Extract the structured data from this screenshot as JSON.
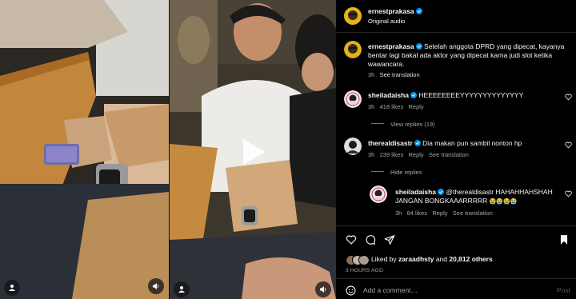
{
  "post": {
    "username": "ernestprakasa",
    "audio": "Original audio",
    "caption_user": "ernestprakasa",
    "caption_line1": "Setelah anggota DPRD yang dipecat, kayanya",
    "caption_line2": "bentar lagi bakal ada aktor yang dipecat karna judi slot ketika",
    "caption_line3": "wawancara.",
    "caption_age": "3h",
    "see_translation": "See translation"
  },
  "comments": [
    {
      "username": "sheiladaisha",
      "text": "HEEEEEEEEYYYYYYYYYYYYYY",
      "age": "3h",
      "likes": "418 likes",
      "reply": "Reply",
      "replies_toggle": "View replies (19)"
    },
    {
      "username": "therealdisastr",
      "text": "Dia makan pun sambil nonton hp",
      "age": "3h",
      "likes": "239 likes",
      "reply": "Reply",
      "translation": "See translation",
      "replies_toggle": "Hide replies"
    }
  ],
  "reply": {
    "username": "sheiladaisha",
    "line1": "@therealdisastr HAHAHHAHSHAH",
    "line2": "JANGAN BONGKAAARRRRR",
    "emoji": "😭😭😭😭",
    "age": "3h",
    "likes": "84 likes",
    "reply": "Reply",
    "translation": "See translation"
  },
  "engagement": {
    "liked_by_prefix": "Liked by ",
    "liked_by_user": "zaraadhsty",
    "liked_by_suffix": " and ",
    "others": "20,812 others",
    "time_ago": "3 HOURS AGO"
  },
  "composer": {
    "placeholder": "Add a comment…",
    "post": "Post"
  },
  "colors": {
    "accent": "#0095f6",
    "verified": "#0095f6",
    "muted": "#a8a8a8",
    "background": "#000000"
  },
  "icons": [
    "play-icon",
    "user-tag-icon",
    "volume-icon",
    "verified-icon",
    "heart-icon",
    "comment-icon",
    "share-icon",
    "bookmark-icon",
    "emoji-icon"
  ]
}
